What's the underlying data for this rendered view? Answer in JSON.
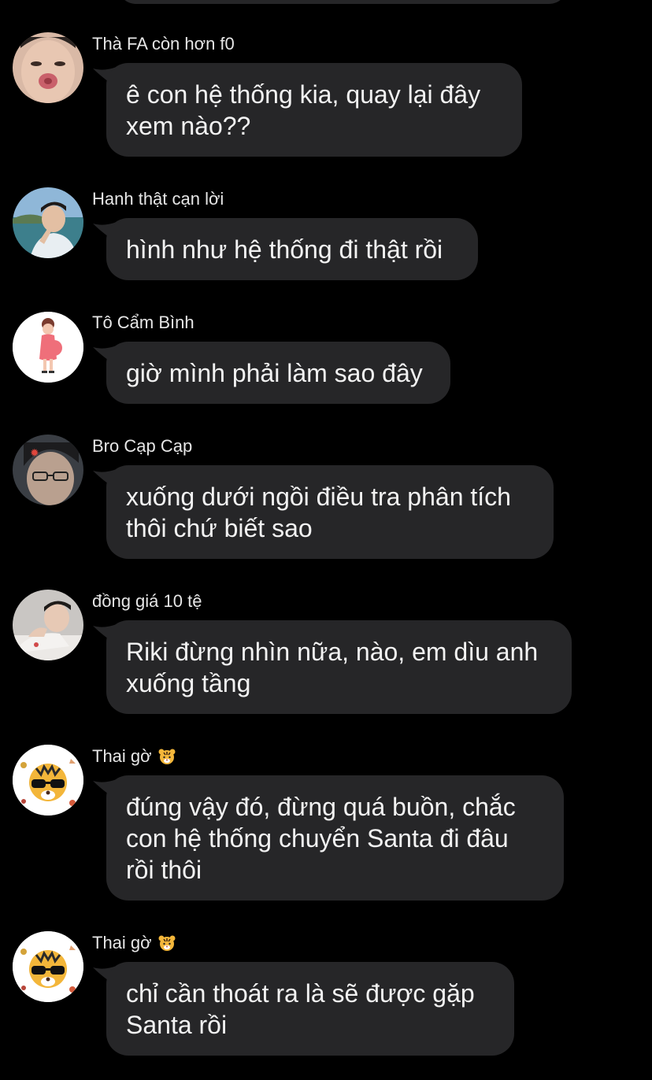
{
  "colors": {
    "background": "#000000",
    "bubble": "#262628",
    "message_text": "#f2f2f2",
    "sender_text": "#e6e6e6"
  },
  "messages": [
    {
      "sender": "Thà FA còn hơn f0",
      "text": "ê con hệ thống kia, quay lại đây\nxem nào??",
      "avatar": "avatar-photo-lips"
    },
    {
      "sender": "Hanh thật cạn lời",
      "text": "hình như hệ thống đi thật rồi",
      "avatar": "avatar-photo-seaside"
    },
    {
      "sender": "Tô Cẩm Bình",
      "text": "giờ mình phải làm sao đây",
      "avatar": "avatar-cartoon-woman"
    },
    {
      "sender": "Bro Cạp Cạp",
      "text": "xuống dưới ngồi điều tra phân tích\nthôi chứ biết sao",
      "avatar": "avatar-photo-glasses"
    },
    {
      "sender": "đồng giá 10 tệ",
      "text": "Riki đừng nhìn nữa, nào, em dìu anh\nxuống tầng",
      "avatar": "avatar-photo-lying"
    },
    {
      "sender": "Thai gờ",
      "sender_emoji": "tiger-face-icon",
      "text": "đúng vậy đó, đừng quá buồn, chắc\ncon hệ thống chuyển Santa đi đâu\nrồi thôi",
      "avatar": "avatar-tiger-sunglasses"
    },
    {
      "sender": "Thai gờ",
      "sender_emoji": "tiger-face-icon",
      "text": "chỉ cần thoát ra là sẽ được gặp\nSanta rồi",
      "avatar": "avatar-tiger-sunglasses"
    }
  ]
}
